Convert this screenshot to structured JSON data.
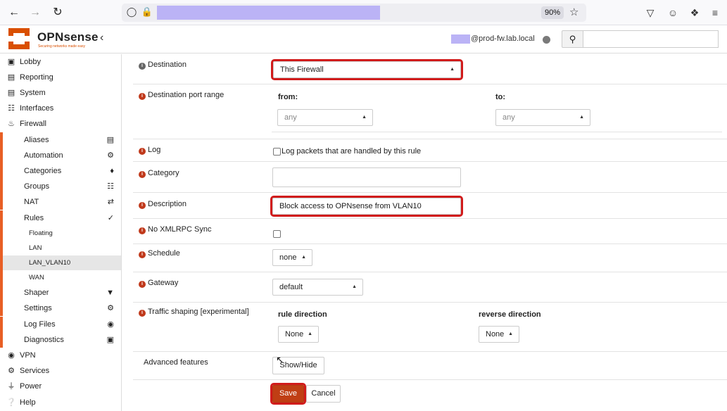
{
  "browser": {
    "zoom": "90%",
    "icons": {
      "back": "arrow-left-icon",
      "forward": "arrow-right-icon",
      "reload": "reload-icon",
      "shield": "shield-icon",
      "lock": "lock-icon",
      "bookmark": "star-icon",
      "pocket": "pocket-icon",
      "account": "account-icon",
      "extensions": "extensions-icon",
      "menu": "hamburger-icon"
    }
  },
  "header": {
    "logo_text": "OPNsense",
    "logo_tagline": "Securing networks made easy",
    "hostname": "@prod-fw.lab.local",
    "brand_color": "#d94f00"
  },
  "sidebar": {
    "items": [
      {
        "label": "Lobby",
        "icon": "laptop-icon"
      },
      {
        "label": "Reporting",
        "icon": "chart-area-icon"
      },
      {
        "label": "System",
        "icon": "server-icon"
      },
      {
        "label": "Interfaces",
        "icon": "sitemap-icon"
      },
      {
        "label": "Firewall",
        "icon": "fire-icon"
      }
    ],
    "firewall_sub": [
      {
        "label": "Aliases",
        "icon": "list-icon"
      },
      {
        "label": "Automation",
        "icon": "gear-icon"
      },
      {
        "label": "Categories",
        "icon": "tags-icon"
      },
      {
        "label": "Groups",
        "icon": "sitemap-icon"
      },
      {
        "label": "NAT",
        "icon": "exchange-icon"
      },
      {
        "label": "Rules",
        "icon": "check-icon"
      }
    ],
    "rules_sub": [
      {
        "label": "Floating"
      },
      {
        "label": "LAN"
      },
      {
        "label": "LAN_VLAN10"
      },
      {
        "label": "WAN"
      }
    ],
    "firewall_sub2": [
      {
        "label": "Shaper",
        "icon": "filter-icon"
      },
      {
        "label": "Settings",
        "icon": "gears-icon"
      },
      {
        "label": "Log Files",
        "icon": "eye-icon"
      },
      {
        "label": "Diagnostics",
        "icon": "medkit-icon"
      }
    ],
    "bottom_items": [
      {
        "label": "VPN",
        "icon": "globe-icon"
      },
      {
        "label": "Services",
        "icon": "gear-icon"
      },
      {
        "label": "Power",
        "icon": "plug-icon"
      },
      {
        "label": "Help",
        "icon": "help-icon"
      }
    ]
  },
  "form": {
    "destination": {
      "label": "Destination",
      "value": "This Firewall"
    },
    "dest_port_range": {
      "label": "Destination port range",
      "from_label": "from:",
      "to_label": "to:",
      "from_value": "any",
      "to_value": "any"
    },
    "log": {
      "label": "Log",
      "checkbox_label": "Log packets that are handled by this rule"
    },
    "category": {
      "label": "Category",
      "value": ""
    },
    "description": {
      "label": "Description",
      "value": "Block access to OPNsense from VLAN10"
    },
    "no_xmlrpc": {
      "label": "No XMLRPC Sync"
    },
    "schedule": {
      "label": "Schedule",
      "value": "none"
    },
    "gateway": {
      "label": "Gateway",
      "value": "default"
    },
    "traffic_shaping": {
      "label": "Traffic shaping [experimental]",
      "rule_direction_label": "rule direction",
      "reverse_direction_label": "reverse direction",
      "rule_direction_value": "None",
      "reverse_direction_value": "None"
    },
    "advanced": {
      "label": "Advanced features",
      "button": "Show/Hide"
    },
    "save_label": "Save",
    "cancel_label": "Cancel"
  }
}
